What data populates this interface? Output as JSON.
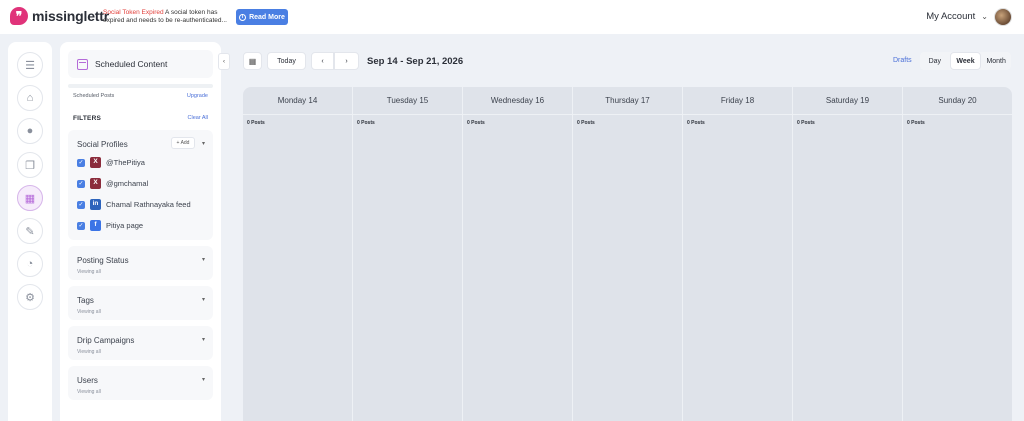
{
  "brand": {
    "name": "missinglettr",
    "accent": "#e0337a"
  },
  "alert": {
    "error_label": "Social Token Expired",
    "message": "A social token has expired and needs to be re-authenticated...",
    "button_label": "Read More"
  },
  "account": {
    "label": "My Account"
  },
  "rail": {
    "items": [
      {
        "icon": "menu-icon"
      },
      {
        "icon": "home-icon"
      },
      {
        "icon": "drop-icon"
      },
      {
        "icon": "content-icon"
      },
      {
        "icon": "calendar-icon",
        "active": true
      },
      {
        "icon": "pen-icon"
      },
      {
        "icon": "pie-chart-icon"
      },
      {
        "icon": "gear-icon"
      }
    ]
  },
  "panel": {
    "title": "Scheduled Content",
    "scheduled_posts_label": "Scheduled Posts",
    "upgrade_label": "Upgrade",
    "filters_label": "FILTERS",
    "clear_all_label": "Clear All",
    "social_profiles": {
      "title": "Social Profiles",
      "add_label": "+ Add",
      "profiles": [
        {
          "network": "x",
          "icon_text": "X",
          "name": "@ThePitiya"
        },
        {
          "network": "x",
          "icon_text": "X",
          "name": "@gmchamal"
        },
        {
          "network": "in",
          "icon_text": "in",
          "name": "Chamal Rathnayaka feed"
        },
        {
          "network": "fb",
          "icon_text": "f",
          "name": "Pitiya page"
        }
      ]
    },
    "sections": [
      {
        "title": "Posting Status",
        "sub": "Viewing all"
      },
      {
        "title": "Tags",
        "sub": "Viewing all"
      },
      {
        "title": "Drip Campaigns",
        "sub": "Viewing all"
      },
      {
        "title": "Users",
        "sub": "Viewing all"
      }
    ]
  },
  "toolbar": {
    "collapse": "‹",
    "today": "Today",
    "prev": "‹",
    "next": "›",
    "range": "Sep 14 - Sep 21, 2026",
    "drafts": "Drafts",
    "views": [
      "Day",
      "Week",
      "Month"
    ],
    "active_view": "Week"
  },
  "calendar": {
    "days": [
      {
        "label": "Monday 14",
        "count": "0 Posts"
      },
      {
        "label": "Tuesday 15",
        "count": "0 Posts"
      },
      {
        "label": "Wednesday 16",
        "count": "0 Posts"
      },
      {
        "label": "Thursday 17",
        "count": "0 Posts"
      },
      {
        "label": "Friday 18",
        "count": "0 Posts"
      },
      {
        "label": "Saturday 19",
        "count": "0 Posts"
      },
      {
        "label": "Sunday 20",
        "count": "0 Posts"
      }
    ]
  }
}
